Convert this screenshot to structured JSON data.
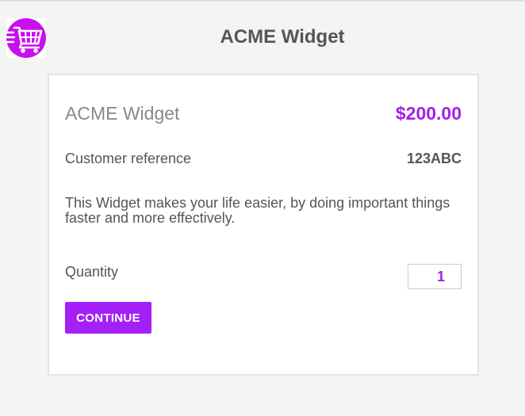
{
  "header": {
    "title": "ACME Widget",
    "logo_icon": "shopping-cart-icon"
  },
  "product": {
    "name": "ACME Widget",
    "price": "$200.00",
    "reference_label": "Customer reference",
    "reference_value": "123ABC",
    "description": "This Widget makes your life easier, by doing important things faster and more effectively.",
    "quantity_label": "Quantity",
    "quantity_value": "1",
    "continue_label": "CONTINUE"
  },
  "colors": {
    "accent": "#a420e6",
    "button": "#a420f6",
    "text": "#555555",
    "muted": "#888888",
    "background": "#f4f4f4"
  }
}
